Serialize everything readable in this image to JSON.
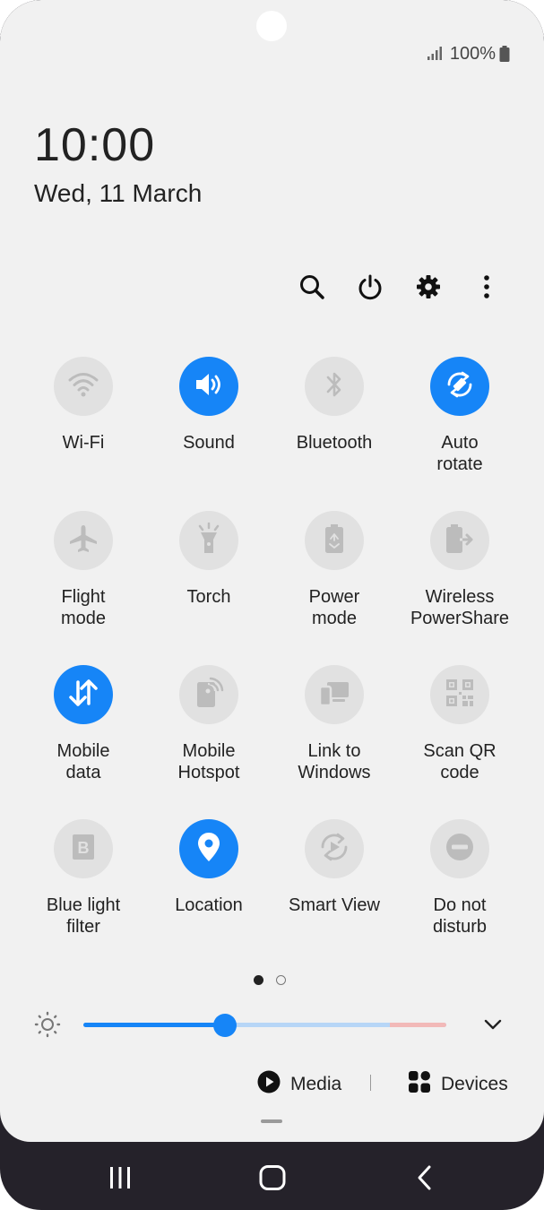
{
  "status_bar": {
    "battery_text": "100%",
    "icons": [
      "signal-icon",
      "battery-icon"
    ]
  },
  "clock": {
    "time": "10:00",
    "date": "Wed, 11 March"
  },
  "toolbar": {
    "icons": [
      "search-icon",
      "power-icon",
      "settings-icon",
      "more-options-icon"
    ]
  },
  "tiles": [
    {
      "label": "Wi-Fi",
      "icon": "wifi-icon",
      "on": false
    },
    {
      "label": "Sound",
      "icon": "sound-icon",
      "on": true
    },
    {
      "label": "Bluetooth",
      "icon": "bluetooth-icon",
      "on": false
    },
    {
      "label": "Auto\nrotate",
      "icon": "auto-rotate-icon",
      "on": true
    },
    {
      "label": "Flight\nmode",
      "icon": "airplane-icon",
      "on": false
    },
    {
      "label": "Torch",
      "icon": "torch-icon",
      "on": false
    },
    {
      "label": "Power\nmode",
      "icon": "power-mode-icon",
      "on": false
    },
    {
      "label": "Wireless\nPowerShare",
      "icon": "wireless-powershare-icon",
      "on": false
    },
    {
      "label": "Mobile\ndata",
      "icon": "mobile-data-icon",
      "on": true
    },
    {
      "label": "Mobile\nHotspot",
      "icon": "hotspot-icon",
      "on": false
    },
    {
      "label": "Link to\nWindows",
      "icon": "link-to-windows-icon",
      "on": false
    },
    {
      "label": "Scan QR\ncode",
      "icon": "qr-code-icon",
      "on": false
    },
    {
      "label": "Blue light\nfilter",
      "icon": "blue-light-filter-icon",
      "on": false
    },
    {
      "label": "Location",
      "icon": "location-icon",
      "on": true
    },
    {
      "label": "Smart View",
      "icon": "smart-view-icon",
      "on": false
    },
    {
      "label": "Do not\ndisturb",
      "icon": "do-not-disturb-icon",
      "on": false
    }
  ],
  "pager": {
    "pages": 2,
    "current": 1
  },
  "brightness": {
    "level": 0.39
  },
  "media_row": {
    "media_label": "Media",
    "devices_label": "Devices"
  },
  "colors": {
    "accent": "#1685f7",
    "tile_off": "#e1e1e1",
    "panel_bg": "#f1f1f1",
    "nav_bg": "#25222a"
  },
  "navigation": {
    "icons": [
      "recent-apps-icon",
      "home-icon",
      "back-icon"
    ]
  }
}
